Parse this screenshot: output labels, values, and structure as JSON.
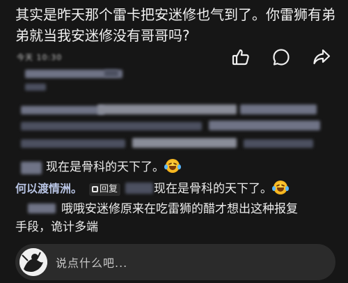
{
  "post": {
    "text": "其实是昨天那个雷卡把安迷修也气到了。你雷狮有弟弟就当我安迷修没有哥哥吗?"
  },
  "meta": {
    "timestamp": "今天 10:30"
  },
  "actions": {
    "like_icon": "thumbs-up",
    "comment_icon": "speech-bubble",
    "share_icon": "share-arrow"
  },
  "replies": [
    {
      "text": "现在是骨科的天下了。",
      "emoji": "laughing-tears"
    },
    {
      "username": "何以渡情洲。",
      "badge": "回复",
      "text": "现在是骨科的天下了。",
      "emoji": "laughing-tears"
    },
    {
      "text_line1": "哦哦安迷修原来在吃雷狮的醋才想出这种报复",
      "text_line2": "手段，诡计多端"
    }
  ],
  "comment_box": {
    "placeholder": "说点什么吧..."
  },
  "colors": {
    "background": "#161616",
    "username": "#b8c4e4",
    "input_bg": "#2b2b2b"
  }
}
